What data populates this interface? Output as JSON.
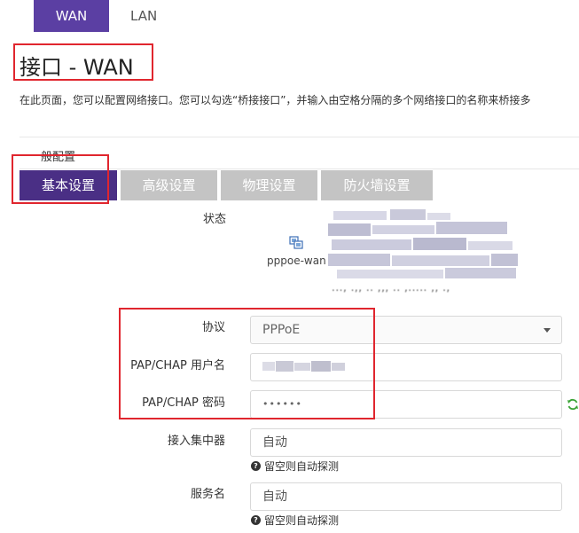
{
  "top_tabs": [
    {
      "label": "WAN",
      "active": true
    },
    {
      "label": "LAN",
      "active": false
    }
  ],
  "page": {
    "title": "接口 - WAN",
    "description": "在此页面，您可以配置网络接口。您可以勾选“桥接接口”，并输入由空格分隔的多个网络接口的名称来桥接多"
  },
  "section": {
    "label": "般配置"
  },
  "sub_tabs": [
    {
      "label": "基本设置",
      "active": true
    },
    {
      "label": "高级设置",
      "active": false
    },
    {
      "label": "物理设置",
      "active": false
    },
    {
      "label": "防火墙设置",
      "active": false
    }
  ],
  "status": {
    "label": "状态",
    "interface_name": "pppoe-wan",
    "masked_tail": "..., .,, .. ,,, .. ,..... ,, .,"
  },
  "fields": {
    "protocol": {
      "label": "协议",
      "value": "PPPoE"
    },
    "username": {
      "label": "PAP/CHAP 用户名",
      "value": ""
    },
    "password": {
      "label": "PAP/CHAP 密码",
      "value": "••••••"
    },
    "concentrator": {
      "label": "接入集中器",
      "placeholder": "自动",
      "hint": "留空则自动探测"
    },
    "service": {
      "label": "服务名",
      "placeholder": "自动",
      "hint": "留空则自动探测"
    }
  },
  "colors": {
    "accent": "#5b3fa3",
    "accent_dark": "#4a2f85",
    "tab_inactive": "#c4c4c4",
    "annotation_red": "#e0262e",
    "refresh_green": "#3aa335"
  }
}
